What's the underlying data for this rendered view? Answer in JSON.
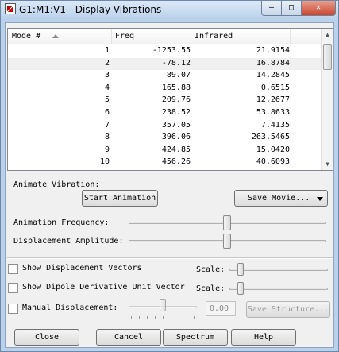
{
  "window": {
    "title": "G1:M1:V1 - Display Vibrations",
    "caption_buttons": {
      "minimize": "–",
      "maximize": "□",
      "close": "✕"
    }
  },
  "table": {
    "columns": [
      "Mode #",
      "Freq",
      "Infrared"
    ],
    "selected_row": 2,
    "rows": [
      {
        "mode": "1",
        "freq": "-1253.55",
        "ir": "21.9154"
      },
      {
        "mode": "2",
        "freq": "-78.12",
        "ir": "16.8784"
      },
      {
        "mode": "3",
        "freq": "89.07",
        "ir": "14.2845"
      },
      {
        "mode": "4",
        "freq": "165.88",
        "ir": "0.6515"
      },
      {
        "mode": "5",
        "freq": "209.76",
        "ir": "12.2677"
      },
      {
        "mode": "6",
        "freq": "238.52",
        "ir": "53.8633"
      },
      {
        "mode": "7",
        "freq": "357.05",
        "ir": "7.4135"
      },
      {
        "mode": "8",
        "freq": "396.06",
        "ir": "263.5465"
      },
      {
        "mode": "9",
        "freq": "424.85",
        "ir": "15.0420"
      },
      {
        "mode": "10",
        "freq": "456.26",
        "ir": "40.6093"
      }
    ]
  },
  "animate": {
    "label": "Animate Vibration:",
    "start_button": "Start Animation",
    "save_movie_button": "Save Movie...",
    "frequency_label": "Animation Frequency:",
    "frequency_level": 0.5,
    "amplitude_label": "Displacement Amplitude:",
    "amplitude_level": 0.5
  },
  "options": {
    "show_vectors_label": "Show Displacement Vectors",
    "show_vectors_checked": false,
    "show_dipole_label": "Show Dipole Derivative Unit Vector",
    "show_dipole_checked": false,
    "scale_label": "Scale:",
    "manual_label": "Manual Displacement:",
    "manual_checked": false,
    "manual_value": "0.00",
    "save_structure_button": "Save Structure..."
  },
  "footer": {
    "close": "Close",
    "cancel": "Cancel",
    "spectrum": "Spectrum",
    "help": "Help"
  },
  "colors": {
    "window_frame": "#b9d1ea",
    "client": "#f0f0f0"
  }
}
